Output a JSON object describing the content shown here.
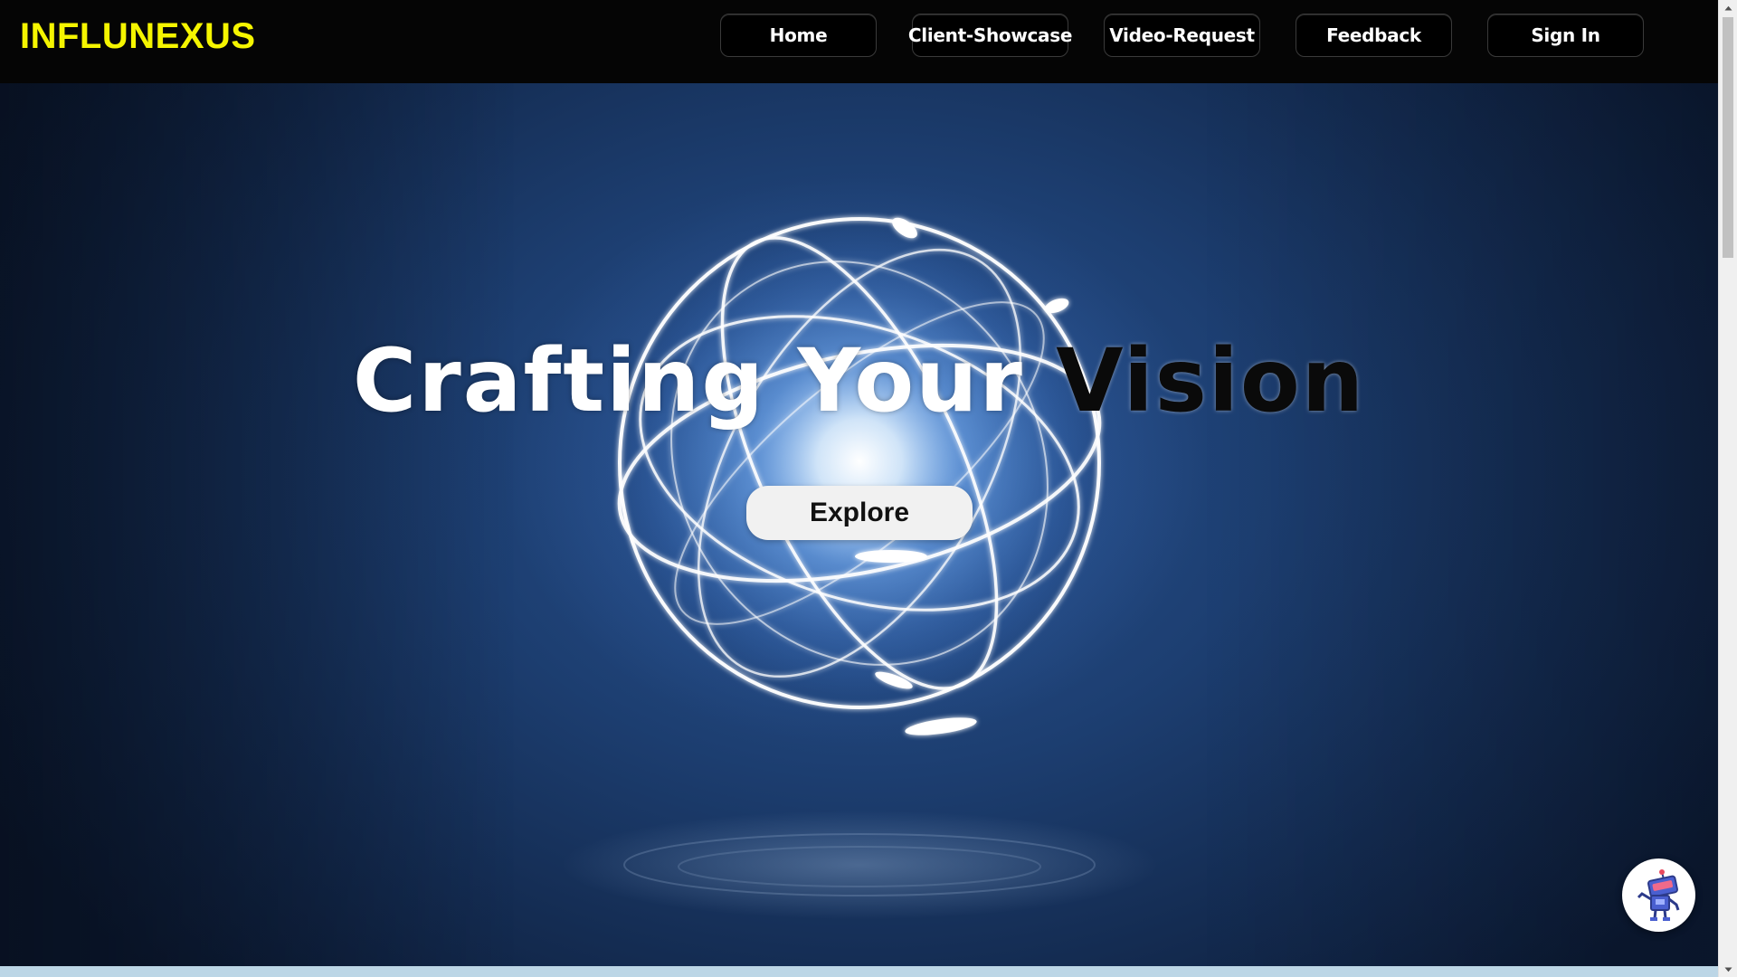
{
  "header": {
    "logo": "INFLUNEXUS",
    "logo_color": "#f5f500",
    "nav": [
      {
        "label": "Home"
      },
      {
        "label": "Client-Showcase"
      },
      {
        "label": "Video-Request"
      },
      {
        "label": "Feedback"
      },
      {
        "label": "Sign In"
      }
    ]
  },
  "hero": {
    "headline_part1": "Crafting ",
    "headline_part2": "Your ",
    "headline_part3": "Vision",
    "explore_label": "Explore",
    "background_color": "#1d3f72"
  },
  "widgets": {
    "chatbot_icon": "robot-icon"
  }
}
